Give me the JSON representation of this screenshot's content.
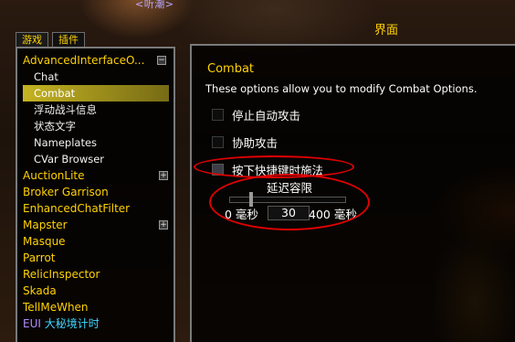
{
  "top_tag": "<听潮>",
  "window_title": "界面",
  "tabs": [
    {
      "label": "游戏"
    },
    {
      "label": "插件"
    }
  ],
  "sidebar": {
    "items": [
      {
        "label": "AdvancedInterfaceO...",
        "expander": "−"
      },
      {
        "label": "Chat"
      },
      {
        "label": "Combat"
      },
      {
        "label": "浮动战斗信息"
      },
      {
        "label": "状态文字"
      },
      {
        "label": "Nameplates"
      },
      {
        "label": "CVar Browser"
      },
      {
        "label": "AuctionLite",
        "expander": "+"
      },
      {
        "label": "Broker Garrison"
      },
      {
        "label": "EnhancedChatFilter"
      },
      {
        "label": "Mapster",
        "expander": "+"
      },
      {
        "label": "Masque"
      },
      {
        "label": "Parrot"
      },
      {
        "label": "RelicInspector"
      },
      {
        "label": "Skada"
      },
      {
        "label": "TellMeWhen"
      },
      {
        "label_prefix": "EUI",
        "label_suffix": "大秘境计时"
      }
    ]
  },
  "panel": {
    "section_title": "Combat",
    "section_desc": "These options allow you to modify Combat Options.",
    "options": [
      {
        "label": "停止自动攻击",
        "checked": false
      },
      {
        "label": "协助攻击",
        "checked": false
      },
      {
        "label": "按下快捷键时施法",
        "checked": false
      }
    ],
    "slider": {
      "label": "延迟容限",
      "min_label": "0 毫秒",
      "max_label": "400 毫秒",
      "value": "30",
      "min": 0,
      "max": 400
    }
  },
  "colors": {
    "accent_gold": "#ffd200",
    "selected_highlight": "#e6d228",
    "annotation_red": "#e00000",
    "eui_purple": "#b38cff",
    "eui_cyan": "#3fd8ff"
  }
}
